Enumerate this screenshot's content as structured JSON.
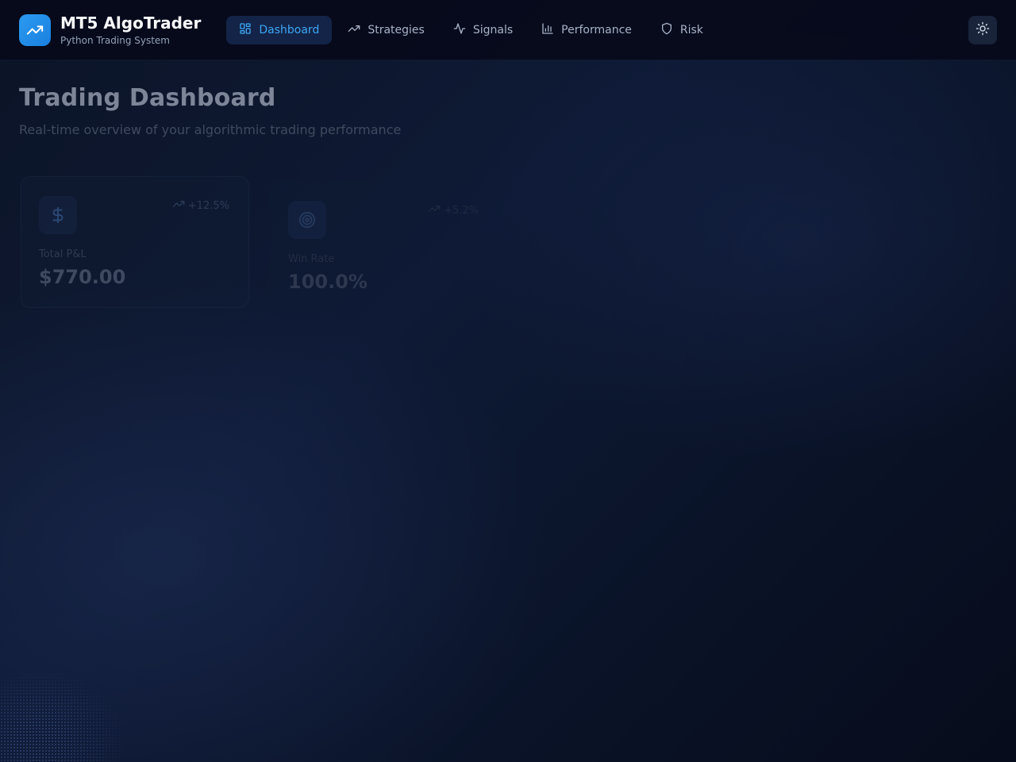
{
  "app": {
    "title": "MT5 AlgoTrader",
    "subtitle": "Python Trading System",
    "logo_icon": "trending-up-icon",
    "accent": "#2b9bf0"
  },
  "nav": {
    "items": [
      {
        "label": "Dashboard",
        "icon": "dashboard-grid-icon",
        "active": true
      },
      {
        "label": "Strategies",
        "icon": "trending-up-icon",
        "active": false
      },
      {
        "label": "Signals",
        "icon": "activity-icon",
        "active": false
      },
      {
        "label": "Performance",
        "icon": "bar-chart-icon",
        "active": false
      },
      {
        "label": "Risk",
        "icon": "shield-icon",
        "active": false
      }
    ]
  },
  "theme_toggle": {
    "icon": "sun-icon"
  },
  "page": {
    "title": "Trading Dashboard",
    "subtitle": "Real-time overview of your algorithmic trading performance"
  },
  "stats": [
    {
      "label": "Total P&L",
      "value": "$770.00",
      "change": "+12.5%",
      "icon": "dollar-icon",
      "change_icon": "trending-up-icon"
    },
    {
      "label": "Win Rate",
      "value": "100.0%",
      "change": "+5.2%",
      "icon": "target-icon",
      "change_icon": "trending-up-icon"
    }
  ]
}
